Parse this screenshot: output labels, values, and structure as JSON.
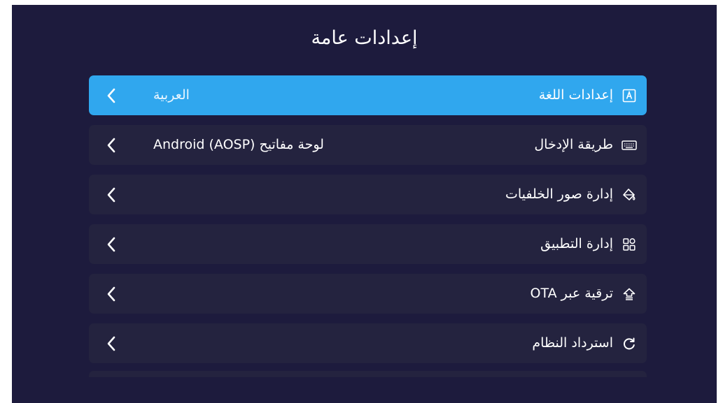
{
  "page": {
    "title": "إعدادات عامة"
  },
  "settings": {
    "items": [
      {
        "label": "إعدادات اللغة",
        "value": "العربية",
        "icon": "language-icon",
        "selected": true
      },
      {
        "label": "طريقة الإدخال",
        "value": "لوحة مفاتيح Android (AOSP)",
        "icon": "keyboard-icon",
        "selected": false
      },
      {
        "label": "إدارة صور الخلفيات",
        "value": "",
        "icon": "wallpaper-icon",
        "selected": false
      },
      {
        "label": "إدارة التطبيق",
        "value": "",
        "icon": "apps-grid-icon",
        "selected": false
      },
      {
        "label": "ترقية عبر OTA",
        "value": "",
        "icon": "upgrade-icon",
        "selected": false
      },
      {
        "label": "استرداد النظام",
        "value": "",
        "icon": "restore-icon",
        "selected": false
      }
    ]
  },
  "colors": {
    "background": "#1d1b3d",
    "row": "#24233f",
    "selected_row": "#30a7ee",
    "text": "#ffffff"
  }
}
